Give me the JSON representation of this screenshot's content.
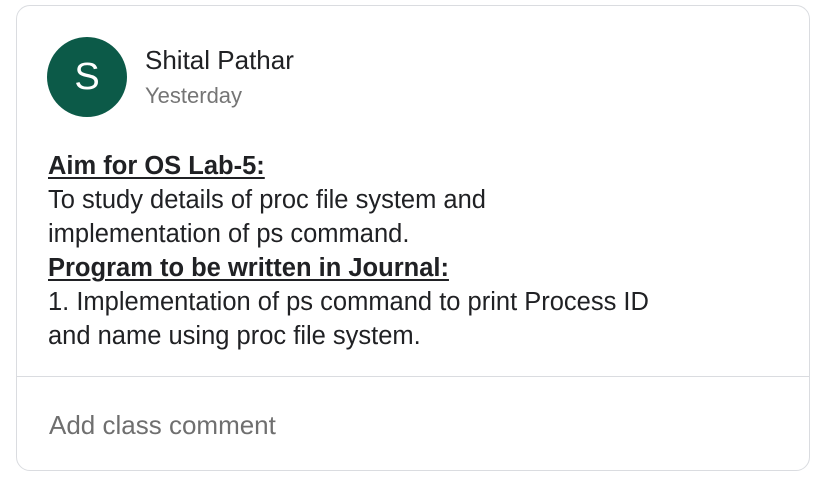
{
  "post": {
    "author": {
      "initial": "S",
      "name": "Shital Pathar",
      "avatar_color": "#0c5a48"
    },
    "timestamp": "Yesterday",
    "body": {
      "aim_heading": "Aim for OS Lab-5:",
      "aim_line_1": "To study details of proc file system and",
      "aim_line_2": "implementation of ps command.",
      "program_heading": "Program to be written in Journal:",
      "program_line_1": "1. Implementation of ps command to print Process ID",
      "program_line_2": "and name using proc file system."
    }
  },
  "comment": {
    "placeholder": "Add class comment"
  }
}
